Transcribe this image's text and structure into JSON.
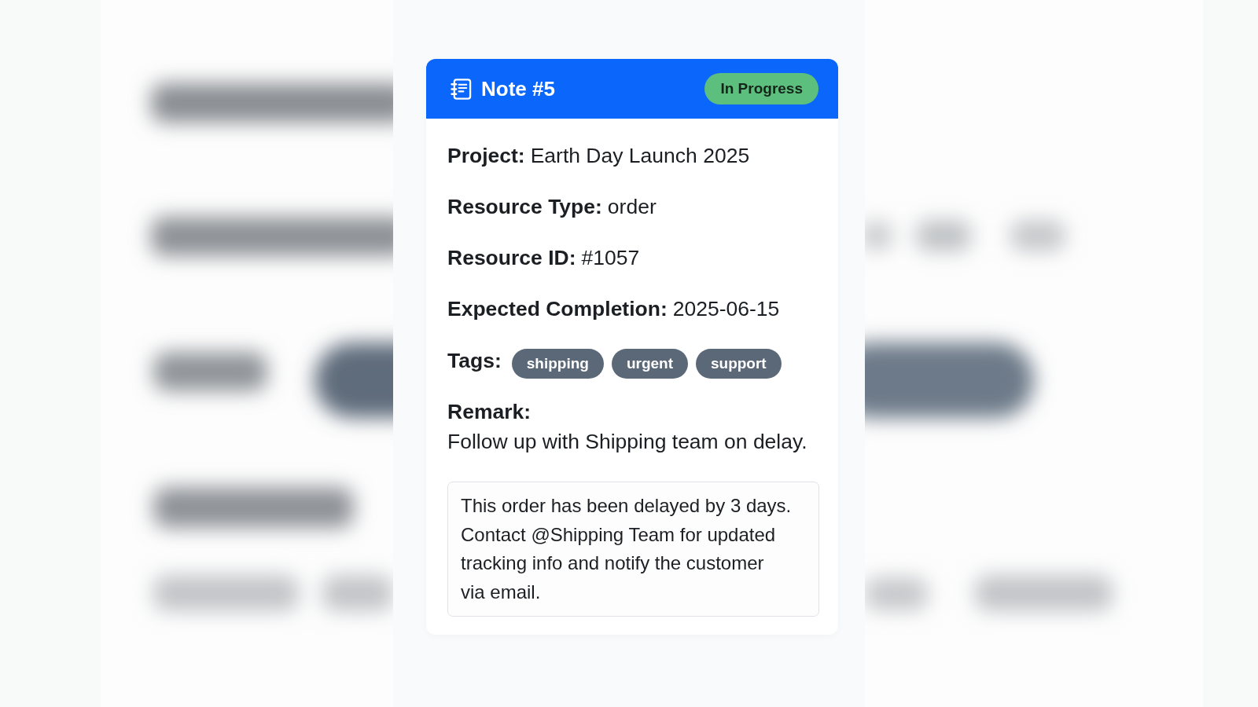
{
  "note": {
    "title": "Note #5",
    "status": "In Progress",
    "fields": [
      {
        "label": "Project:",
        "value": "Earth Day Launch 2025"
      },
      {
        "label": "Resource Type:",
        "value": "order"
      },
      {
        "label": "Resource ID:",
        "value": "#1057"
      },
      {
        "label": "Expected Completion:",
        "value": "2025-06-15"
      }
    ],
    "tags": {
      "label": "Tags:",
      "items": [
        "shipping",
        "urgent",
        "support"
      ]
    },
    "remark": {
      "label": "Remark:",
      "text": "Follow up with Shipping team on delay."
    },
    "message": "This order has been delayed by 3 days. Contact @Shipping Team for updated tracking info and notify the customer via email."
  }
}
